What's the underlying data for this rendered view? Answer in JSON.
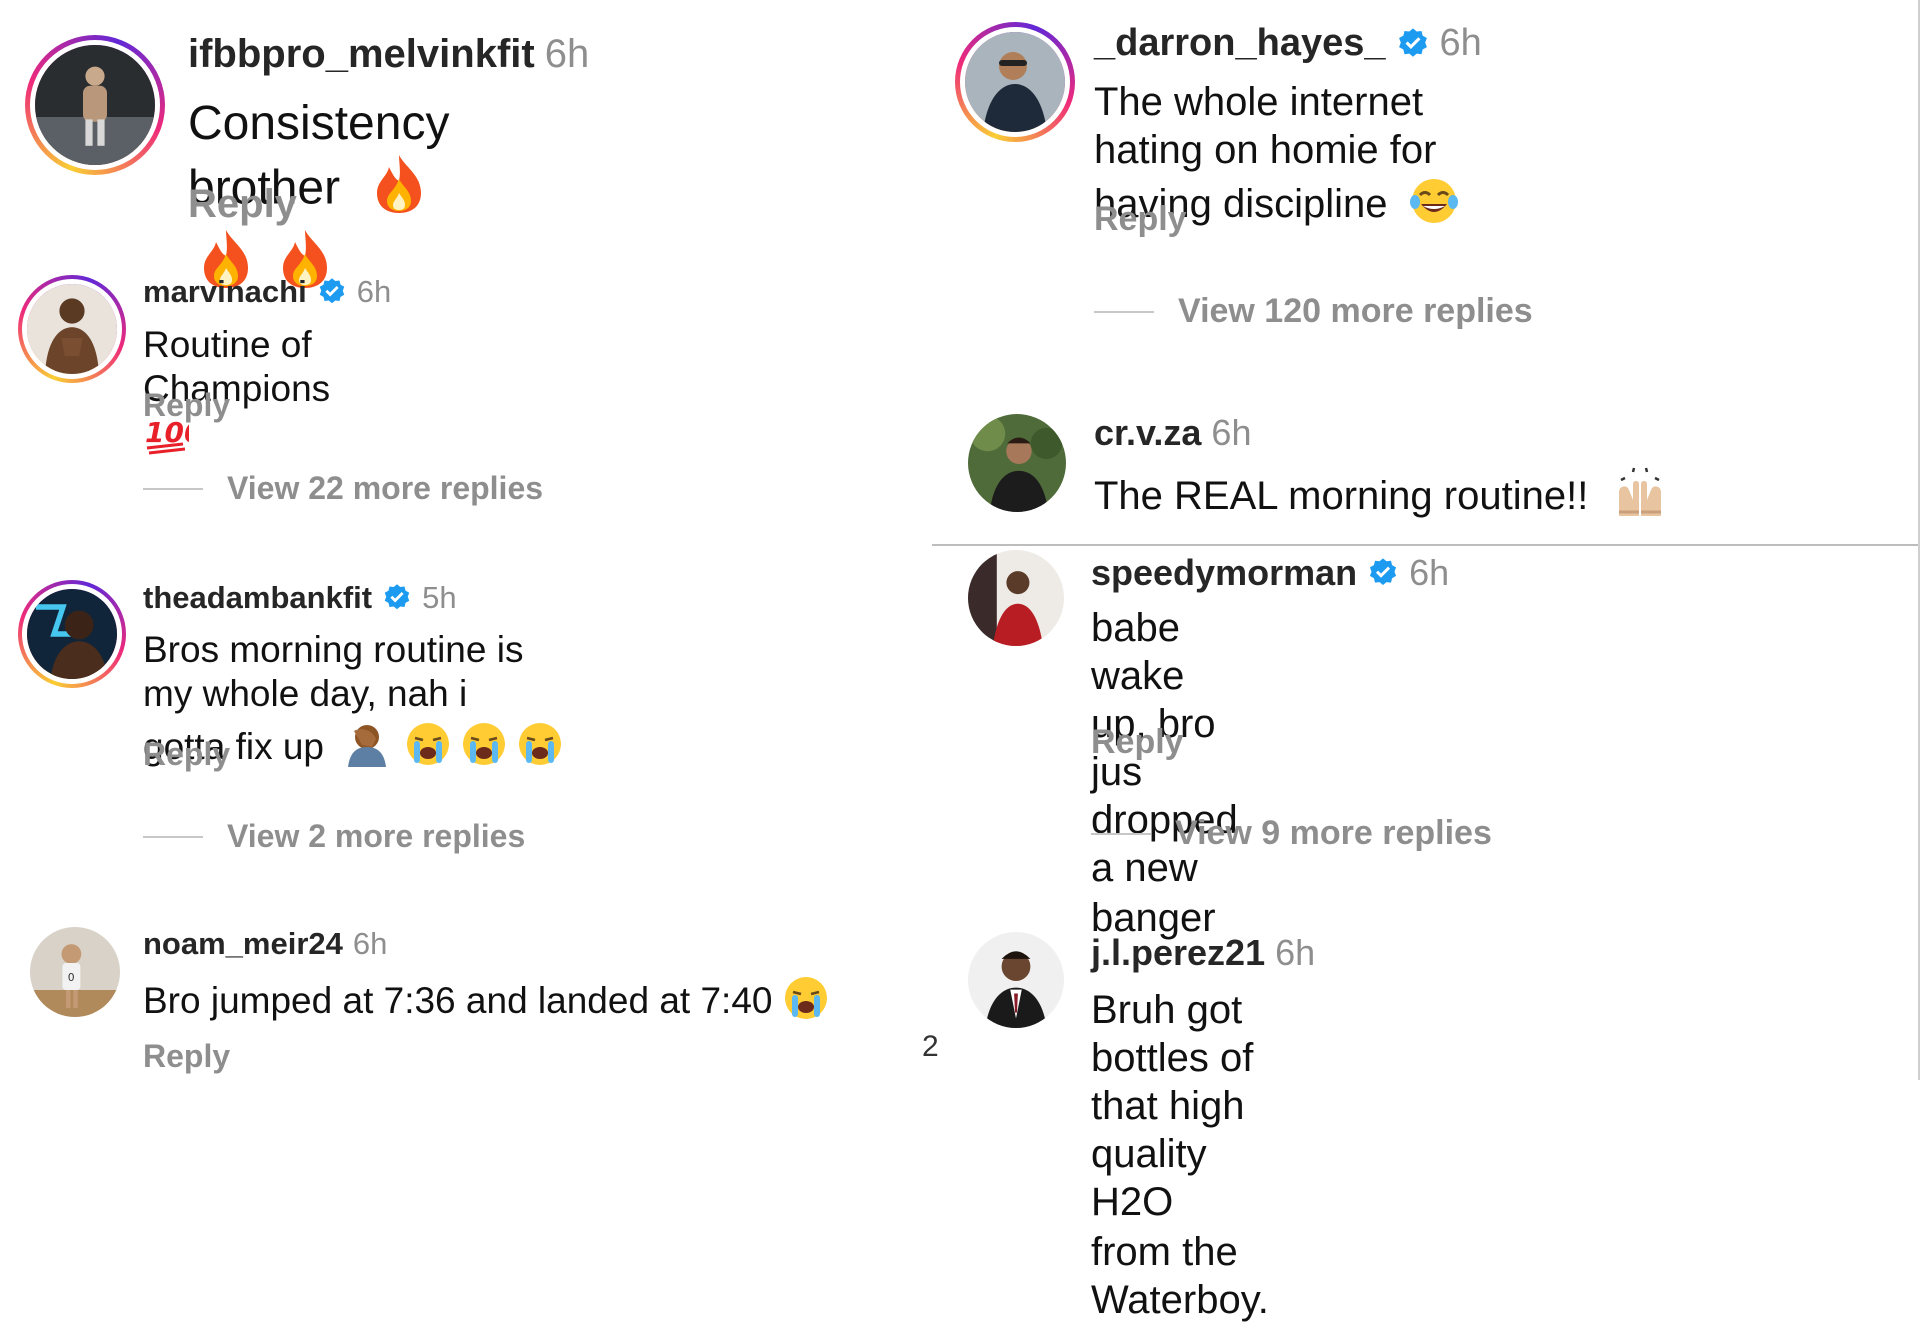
{
  "colors": {
    "username": "#262626",
    "meta": "#8e8e8e",
    "verified": "#1d9bf0",
    "ring": "#ee2a7b"
  },
  "comments": [
    {
      "user": "ifbbpro_melvinkfit",
      "verified": false,
      "time": "6h",
      "text": "Consistency brother",
      "emojis": [
        "fire",
        "fire",
        "fire"
      ],
      "reply": "Reply"
    },
    {
      "user": "marvinachi",
      "verified": true,
      "time": "6h",
      "text": "Routine of Champions",
      "emojis": [
        "hundred"
      ],
      "reply": "Reply",
      "view_more": "View 22 more replies"
    },
    {
      "user": "theadambankfit",
      "verified": true,
      "time": "5h",
      "text_line1": "Bros morning routine is my whole day, nah i",
      "text_line2": "gotta fix up",
      "emojis": [
        "facepalm",
        "crying",
        "crying",
        "crying"
      ],
      "reply": "Reply",
      "view_more": "View 2 more replies"
    },
    {
      "user": "noam_meir24",
      "verified": false,
      "time": "6h",
      "text": "Bro jumped at 7:36 and landed at 7:40",
      "emojis": [
        "crying"
      ],
      "reply": "Reply"
    },
    {
      "user": "_darron_hayes_",
      "verified": true,
      "time": "6h",
      "text_line1": "The whole internet hating on homie for",
      "text_line2": "having discipline",
      "emojis": [
        "joy"
      ],
      "reply": "Reply",
      "view_more": "View 120 more replies"
    },
    {
      "user": "cr.v.za",
      "verified": false,
      "time": "6h",
      "text": "The REAL morning routine!!",
      "emojis": [
        "raised-hands"
      ]
    },
    {
      "user": "speedymorman",
      "verified": true,
      "time": "6h",
      "text_line1": "babe wake up, bro jus dropped a new",
      "text_line2": "banger",
      "reply": "Reply",
      "view_more": "View 9 more replies"
    },
    {
      "user": "j.l.perez21",
      "verified": false,
      "time": "6h",
      "text_line1": "Bruh got bottles of that high quality H2O",
      "text_line2": "from the Waterboy."
    }
  ],
  "page_mark": "2"
}
